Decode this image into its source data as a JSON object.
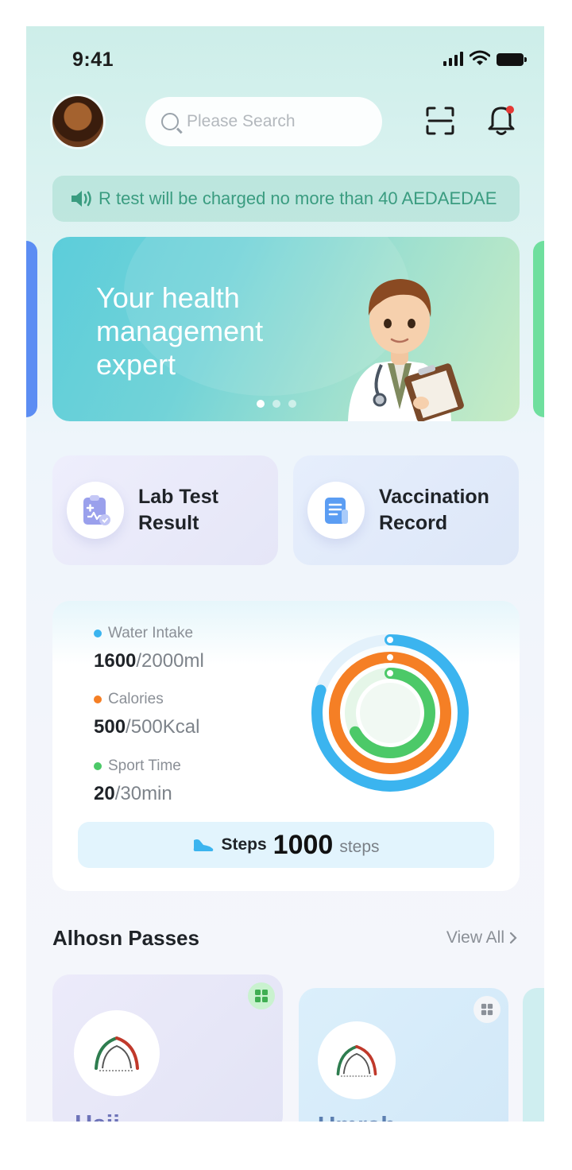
{
  "status_bar": {
    "time": "9:41"
  },
  "header": {
    "search_placeholder": "Please Search"
  },
  "notice": {
    "text": "R  test will be charged no more than 40 AEDAEDAE"
  },
  "banner": {
    "title": "Your health management expert",
    "slide_count": 3,
    "active_slide": 0
  },
  "quick_actions": [
    {
      "label": "Lab Test Result",
      "icon": "lab-report-icon"
    },
    {
      "label": "Vaccination Record",
      "icon": "document-list-icon"
    }
  ],
  "health": {
    "metrics": [
      {
        "name": "Water Intake",
        "value": "1600",
        "goal": "/2000ml",
        "color": "#3bb4ef",
        "progress": 0.8
      },
      {
        "name": "Calories",
        "value": "500",
        "goal": "/500Kcal",
        "color": "#f57f25",
        "progress": 1.0
      },
      {
        "name": "Sport Time",
        "value": "20",
        "goal": "/30min",
        "color": "#4cc968",
        "progress": 0.67
      }
    ],
    "steps_label": "Steps",
    "steps_value": "1000",
    "steps_unit": "steps"
  },
  "passes": {
    "title": "Alhosn Passes",
    "view_all": "View All",
    "items": [
      {
        "name": "Hajj"
      },
      {
        "name": "Umrah"
      }
    ]
  },
  "colors": {
    "accent_teal": "#3a9c80",
    "notify_dot": "#e53935"
  }
}
